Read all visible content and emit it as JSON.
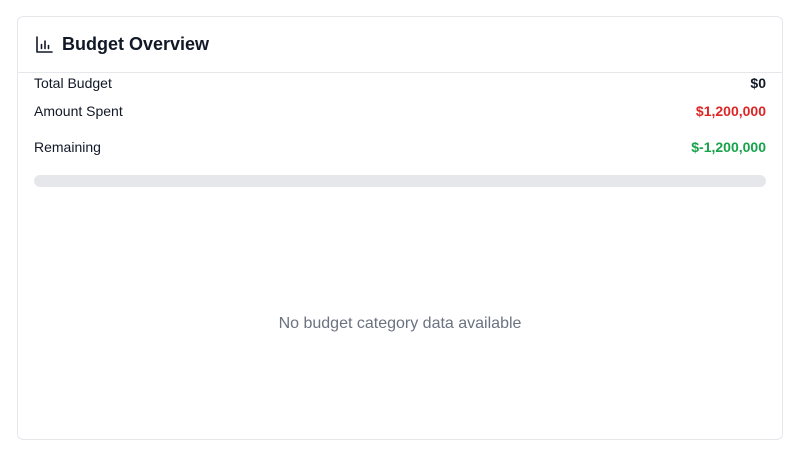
{
  "card": {
    "title": "Budget Overview",
    "icon": "bar-chart-icon"
  },
  "stats": [
    {
      "label": "Total Budget",
      "value": "$0"
    },
    {
      "label": "Amount Spent",
      "value": "$1,200,000"
    },
    {
      "label": "Remaining",
      "value": "$-1,200,000"
    }
  ],
  "progress": {
    "spent_fraction": 0
  },
  "empty_state": {
    "message": "No budget category data available"
  },
  "colors": {
    "spent": "#dc2626",
    "remaining": "#16a34a",
    "track": "#e5e7eb"
  }
}
